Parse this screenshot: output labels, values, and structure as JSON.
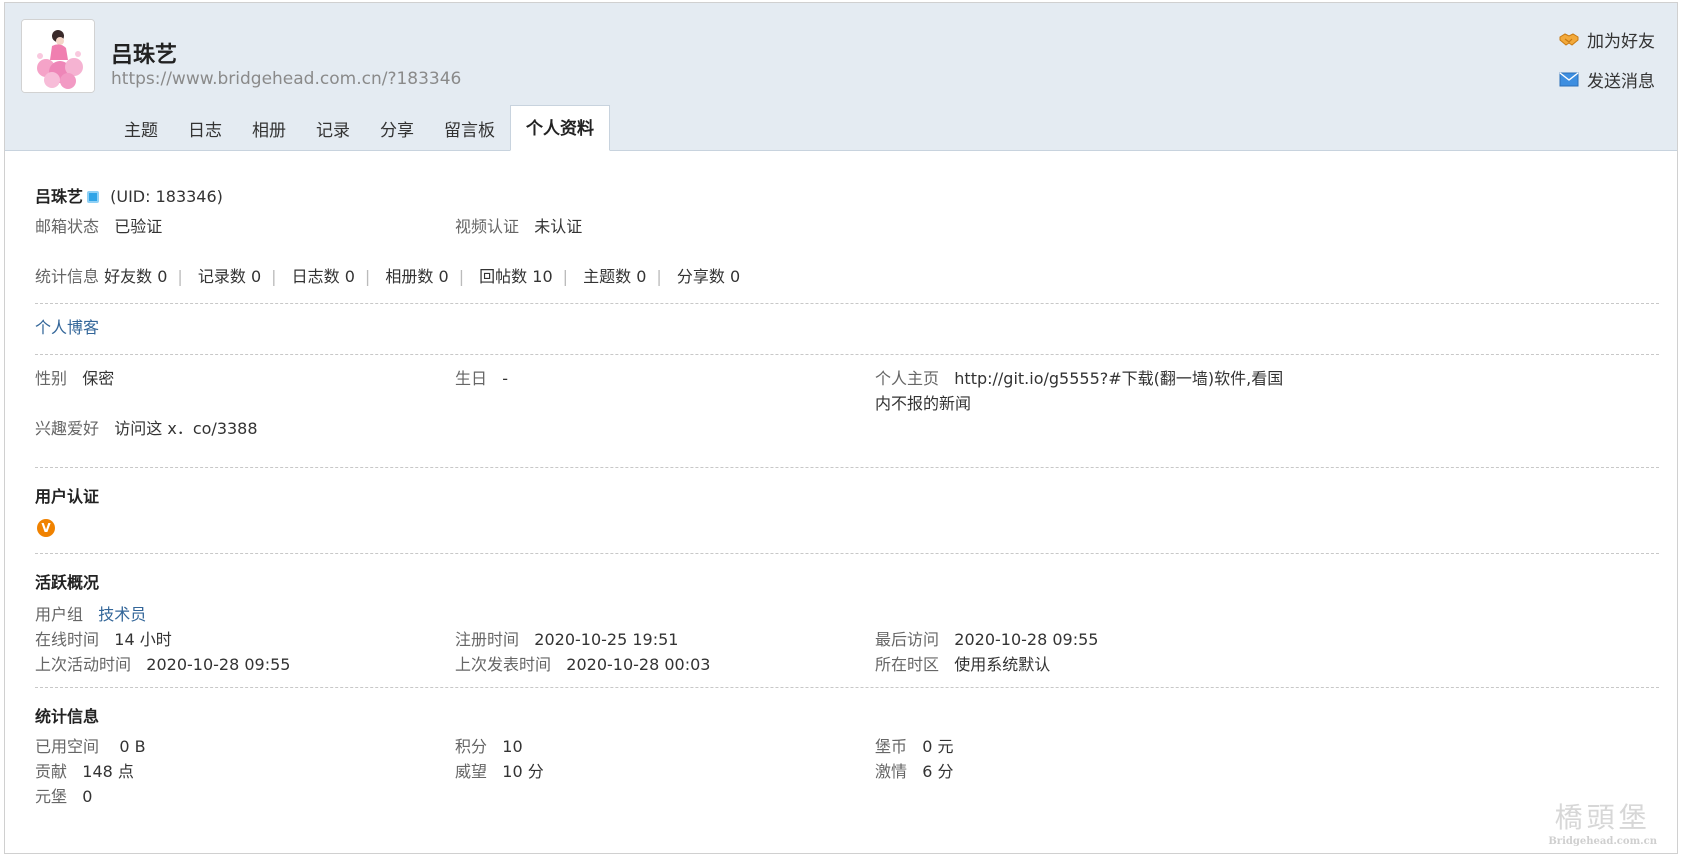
{
  "profile": {
    "name": "吕珠艺",
    "url": "https://www.bridgehead.com.cn/?183346",
    "uid_text": "(UID: 183346)"
  },
  "actions": {
    "add_friend": "加为好友",
    "send_message": "发送消息"
  },
  "tabs": [
    {
      "label": "主题"
    },
    {
      "label": "日志"
    },
    {
      "label": "相册"
    },
    {
      "label": "记录"
    },
    {
      "label": "分享"
    },
    {
      "label": "留言板"
    },
    {
      "label": "个人资料"
    }
  ],
  "basic": {
    "email_label": "邮箱状态",
    "email_value": "已验证",
    "video_label": "视频认证",
    "video_value": "未认证"
  },
  "stats_line": {
    "label": "统计信息",
    "items": [
      "好友数 0",
      "记录数 0",
      "日志数 0",
      "相册数 0",
      "回帖数 10",
      "主题数 0",
      "分享数 0"
    ]
  },
  "blog_link": "个人博客",
  "personal": {
    "gender_label": "性别",
    "gender_value": "保密",
    "birthday_label": "生日",
    "birthday_value": "-",
    "homepage_label": "个人主页",
    "homepage_line1": "http://git.io/g5555?#下载(翻一墙)软件,看国",
    "homepage_line2": "内不报的新闻",
    "hobby_label": "兴趣爱好",
    "hobby_value": "访问这 x．co/3388"
  },
  "verification": {
    "title": "用户认证",
    "badge": "V"
  },
  "activity": {
    "title": "活跃概况",
    "group_label": "用户组",
    "group_value": "技术员",
    "online_label": "在线时间",
    "online_value": "14 小时",
    "reg_label": "注册时间",
    "reg_value": "2020-10-25 19:51",
    "last_visit_label": "最后访问",
    "last_visit_value": "2020-10-28 09:55",
    "last_active_label": "上次活动时间",
    "last_active_value": "2020-10-28 09:55",
    "last_post_label": "上次发表时间",
    "last_post_value": "2020-10-28 00:03",
    "timezone_label": "所在时区",
    "timezone_value": "使用系统默认"
  },
  "statistics": {
    "title": "统计信息",
    "space_label": "已用空间",
    "space_value": "0 B",
    "points_label": "积分",
    "points_value": "10",
    "coins_label": "堡币",
    "coins_value": "0 元",
    "contrib_label": "贡献",
    "contrib_value": "148 点",
    "prestige_label": "威望",
    "prestige_value": "10 分",
    "passion_label": "激情",
    "passion_value": "6 分",
    "yuanbao_label": "元堡",
    "yuanbao_value": "0"
  },
  "watermark": {
    "main": "橋頭堡",
    "sub": "Bridgehead.com.cn"
  },
  "colors": {
    "header_bg": "#e4ebf2",
    "link": "#336699",
    "badge": "#f08200",
    "online": "#2fa4e7"
  }
}
